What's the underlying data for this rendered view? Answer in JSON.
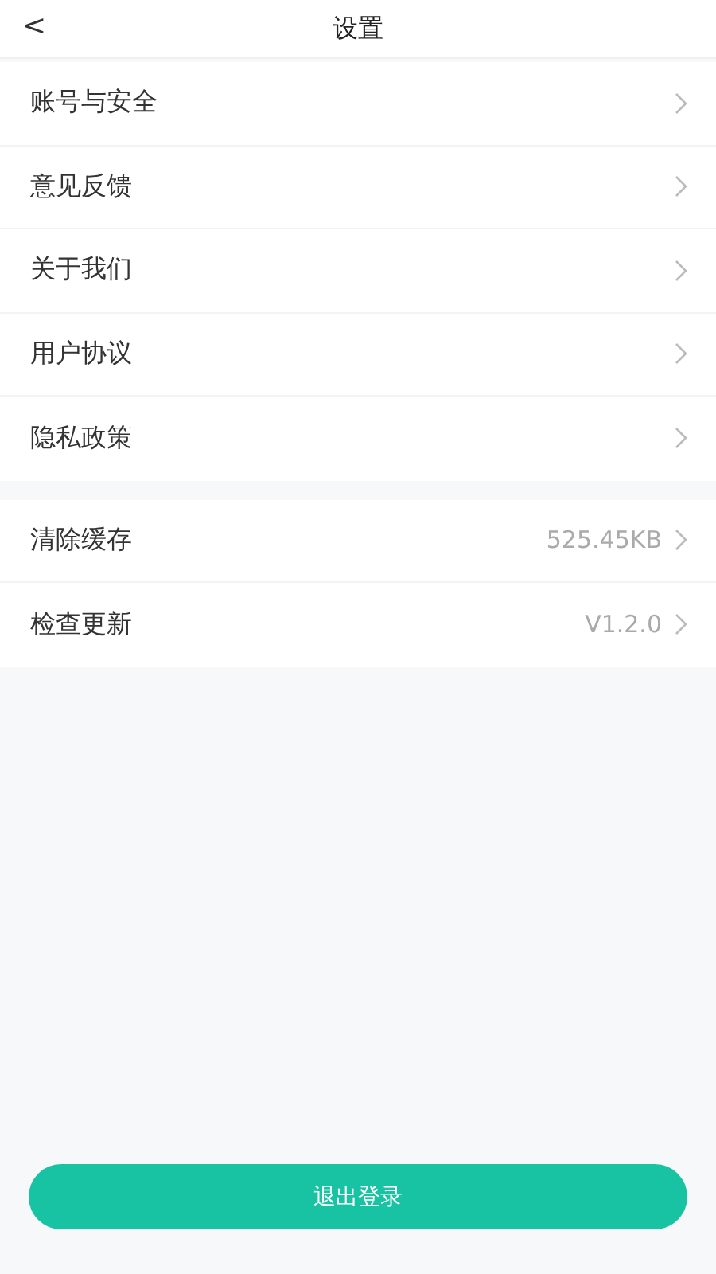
{
  "header": {
    "back": "<",
    "title": "设置"
  },
  "groups": [
    {
      "rows": [
        {
          "label": "账号与安全"
        },
        {
          "label": "意见反馈"
        },
        {
          "label": "关于我们"
        },
        {
          "label": "用户协议"
        },
        {
          "label": "隐私政策"
        }
      ]
    },
    {
      "rows": [
        {
          "label": "清除缓存",
          "value": "525.45KB"
        },
        {
          "label": "检查更新",
          "value": "V1.2.0"
        }
      ]
    }
  ],
  "logout_button": "退出登录"
}
